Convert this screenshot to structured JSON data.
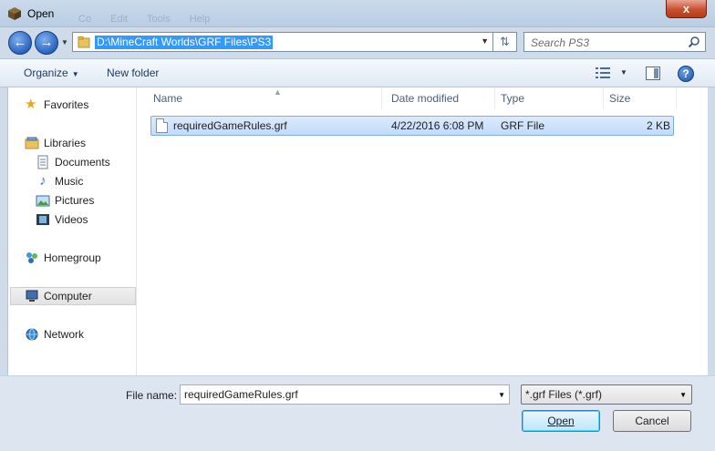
{
  "window": {
    "title": "Open",
    "close_glyph": "x",
    "ghost_menu": [
      "Co",
      "Edit",
      "Tools",
      "Help"
    ]
  },
  "address": {
    "path": "D:\\MineCraft Worlds\\GRF Files\\PS3",
    "search_placeholder": "Search PS3"
  },
  "toolbar": {
    "organize_label": "Organize",
    "new_folder_label": "New folder"
  },
  "sidebar": {
    "favorites": "Favorites",
    "libraries": "Libraries",
    "documents": "Documents",
    "music": "Music",
    "pictures": "Pictures",
    "videos": "Videos",
    "homegroup": "Homegroup",
    "computer": "Computer",
    "network": "Network"
  },
  "columns": {
    "name": "Name",
    "date_modified": "Date modified",
    "type": "Type",
    "size": "Size"
  },
  "files": [
    {
      "name": "requiredGameRules.grf",
      "date_modified": "4/22/2016 6:08 PM",
      "type": "GRF File",
      "size": "2 KB"
    }
  ],
  "footer": {
    "file_name_label": "File name:",
    "file_name_value": "requiredGameRules.grf",
    "filter_value": "*.grf Files (*.grf)",
    "open_label": "Open",
    "cancel_label": "Cancel"
  },
  "colors": {
    "selection": "#c1dbfc",
    "address_highlight": "#3399ff",
    "close_button": "#c7502f"
  }
}
